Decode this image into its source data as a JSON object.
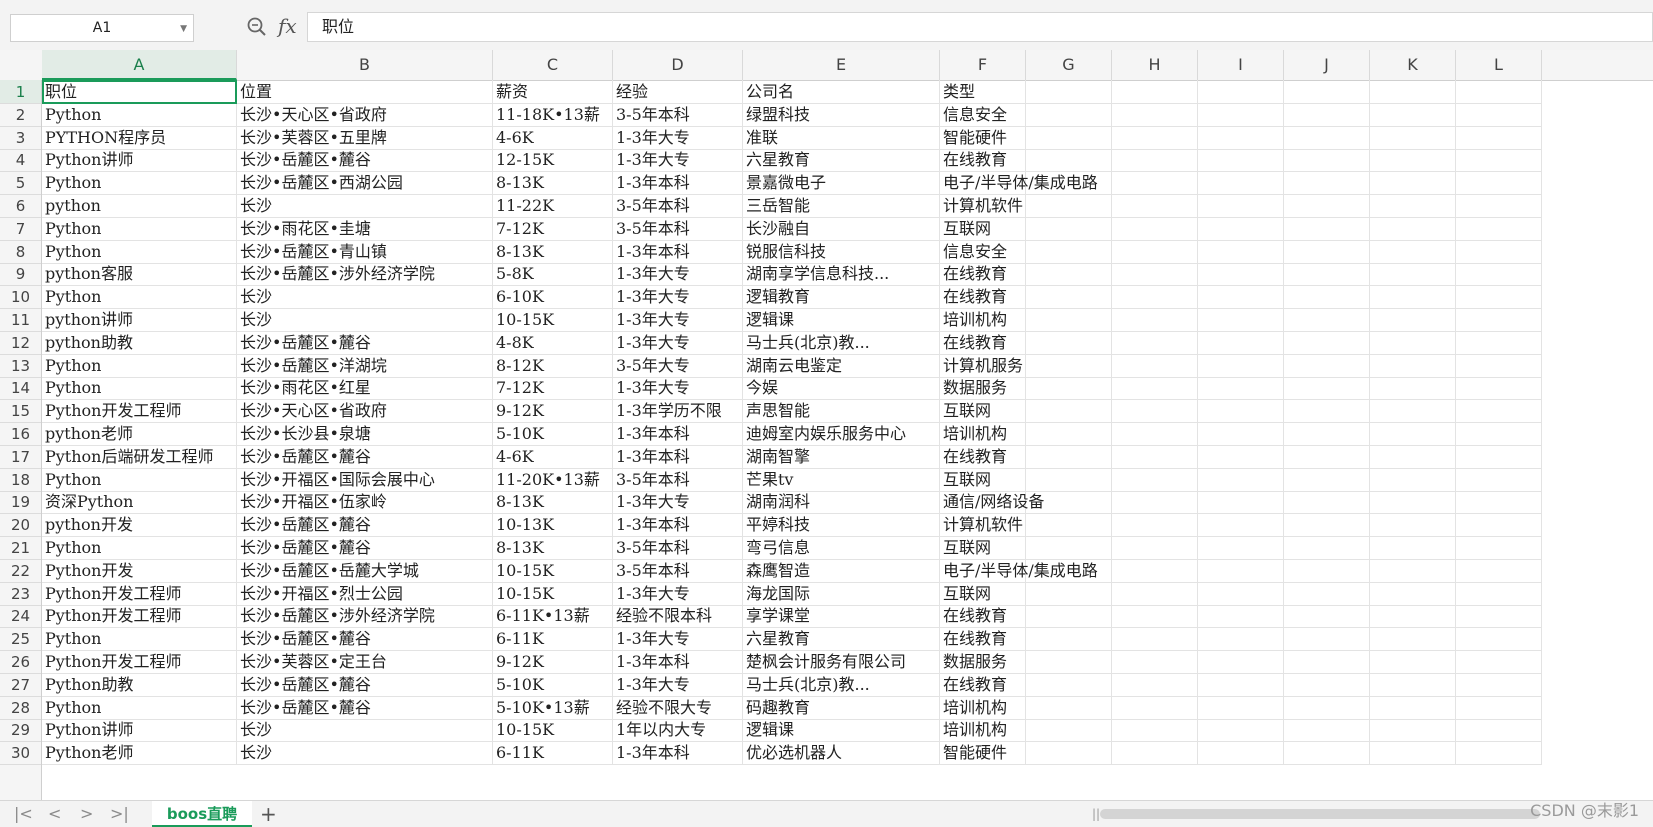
{
  "formula_bar": {
    "name_box": "A1",
    "formula": "职位",
    "zoom_icon": "zoom-icon",
    "fx_label": "fx"
  },
  "columns": [
    "A",
    "B",
    "C",
    "D",
    "E",
    "F",
    "G",
    "H",
    "I",
    "J",
    "K",
    "L"
  ],
  "active_column": "A",
  "active_row": 1,
  "rows": [
    [
      "职位",
      "位置",
      "薪资",
      "经验",
      "公司名",
      "类型"
    ],
    [
      "Python",
      "长沙•天心区•省政府",
      "11-18K•13薪",
      "3-5年本科",
      "绿盟科技",
      "信息安全"
    ],
    [
      "PYTHON程序员",
      "长沙•芙蓉区•五里牌",
      "4-6K",
      "1-3年大专",
      "准联",
      "智能硬件"
    ],
    [
      "Python讲师",
      "长沙•岳麓区•麓谷",
      "12-15K",
      "1-3年大专",
      "六星教育",
      "在线教育"
    ],
    [
      "Python",
      "长沙•岳麓区•西湖公园",
      "8-13K",
      "1-3年本科",
      "景嘉微电子",
      "电子/半导体/集成电路"
    ],
    [
      "python",
      "长沙",
      "11-22K",
      "3-5年本科",
      "三岳智能",
      "计算机软件"
    ],
    [
      "Python",
      "长沙•雨花区•圭塘",
      "7-12K",
      "3-5年本科",
      "长沙融自",
      "互联网"
    ],
    [
      "Python",
      "长沙•岳麓区•青山镇",
      "8-13K",
      "1-3年本科",
      "锐服信科技",
      "信息安全"
    ],
    [
      "python客服",
      "长沙•岳麓区•涉外经济学院",
      "5-8K",
      "1-3年大专",
      "湖南享学信息科技...",
      "在线教育"
    ],
    [
      "Python",
      "长沙",
      "6-10K",
      "1-3年大专",
      "逻辑教育",
      "在线教育"
    ],
    [
      "python讲师",
      "长沙",
      "10-15K",
      "1-3年大专",
      "逻辑课",
      "培训机构"
    ],
    [
      "python助教",
      "长沙•岳麓区•麓谷",
      "4-8K",
      "1-3年大专",
      "马士兵(北京)教...",
      "在线教育"
    ],
    [
      "Python",
      "长沙•岳麓区•洋湖垸",
      "8-12K",
      "3-5年大专",
      "湖南云电鉴定",
      "计算机服务"
    ],
    [
      "Python",
      "长沙•雨花区•红星",
      "7-12K",
      "1-3年大专",
      "今娱",
      "数据服务"
    ],
    [
      "Python开发工程师",
      "长沙•天心区•省政府",
      "9-12K",
      "1-3年学历不限",
      "声思智能",
      "互联网"
    ],
    [
      "python老师",
      "长沙•长沙县•泉塘",
      "5-10K",
      "1-3年本科",
      "迪姆室内娱乐服务中心",
      "培训机构"
    ],
    [
      "Python后端研发工程师",
      "长沙•岳麓区•麓谷",
      "4-6K",
      "1-3年本科",
      "湖南智擎",
      "在线教育"
    ],
    [
      "Python",
      "长沙•开福区•国际会展中心",
      "11-20K•13薪",
      "3-5年本科",
      "芒果tv",
      "互联网"
    ],
    [
      "资深Python",
      "长沙•开福区•伍家岭",
      "8-13K",
      "1-3年大专",
      "湖南润科",
      "通信/网络设备"
    ],
    [
      "python开发",
      "长沙•岳麓区•麓谷",
      "10-13K",
      "1-3年本科",
      "平婷科技",
      "计算机软件"
    ],
    [
      "Python",
      "长沙•岳麓区•麓谷",
      "8-13K",
      "3-5年本科",
      "弯弓信息",
      "互联网"
    ],
    [
      "Python开发",
      "长沙•岳麓区•岳麓大学城",
      "10-15K",
      "3-5年本科",
      "森鹰智造",
      "电子/半导体/集成电路"
    ],
    [
      "Python开发工程师",
      "长沙•开福区•烈士公园",
      "10-15K",
      "1-3年大专",
      "海龙国际",
      "互联网"
    ],
    [
      "Python开发工程师",
      "长沙•岳麓区•涉外经济学院",
      "6-11K•13薪",
      "经验不限本科",
      "享学课堂",
      "在线教育"
    ],
    [
      "Python",
      "长沙•岳麓区•麓谷",
      "6-11K",
      "1-3年大专",
      "六星教育",
      "在线教育"
    ],
    [
      "Python开发工程师",
      "长沙•芙蓉区•定王台",
      "9-12K",
      "1-3年本科",
      "楚枫会计服务有限公司",
      "数据服务"
    ],
    [
      "Python助教",
      "长沙•岳麓区•麓谷",
      "5-10K",
      "1-3年大专",
      "马士兵(北京)教...",
      "在线教育"
    ],
    [
      "Python",
      "长沙•岳麓区•麓谷",
      "5-10K•13薪",
      "经验不限大专",
      "码趣教育",
      "培训机构"
    ],
    [
      "Python讲师",
      "长沙",
      "10-15K",
      "1年以内大专",
      "逻辑课",
      "培训机构"
    ],
    [
      "Python老师",
      "长沙",
      "6-11K",
      "1-3年本科",
      "优必选机器人",
      "智能硬件"
    ]
  ],
  "sheet_tab": {
    "label": "boos直聘"
  },
  "nav": {
    "first": "|<",
    "prev": "<",
    "next": ">",
    "last": ">|",
    "add": "+"
  },
  "watermark": "CSDN @末影1"
}
